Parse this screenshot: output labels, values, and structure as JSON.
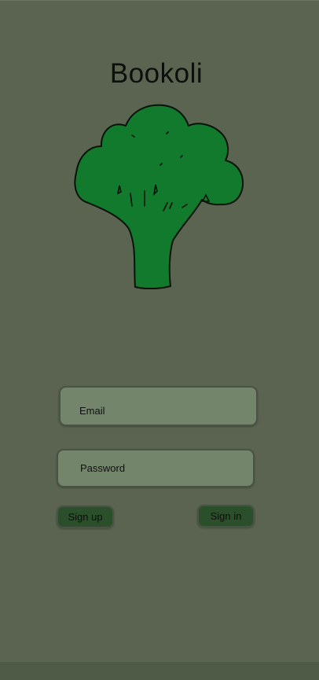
{
  "app": {
    "title": "Bookoli"
  },
  "logo": {
    "icon": "broccoli-icon",
    "fill_color": "#127a2c",
    "outline_color": "#0a120a"
  },
  "login_form": {
    "email_placeholder": "Email",
    "password_placeholder": "Password",
    "signup_label": "Sign up",
    "signin_label": "Sign in"
  },
  "colors": {
    "background": "#5a6450",
    "field_background": "#73856a",
    "button_background": "#2b4f2a",
    "bottom_bar": "#4f5a47"
  }
}
